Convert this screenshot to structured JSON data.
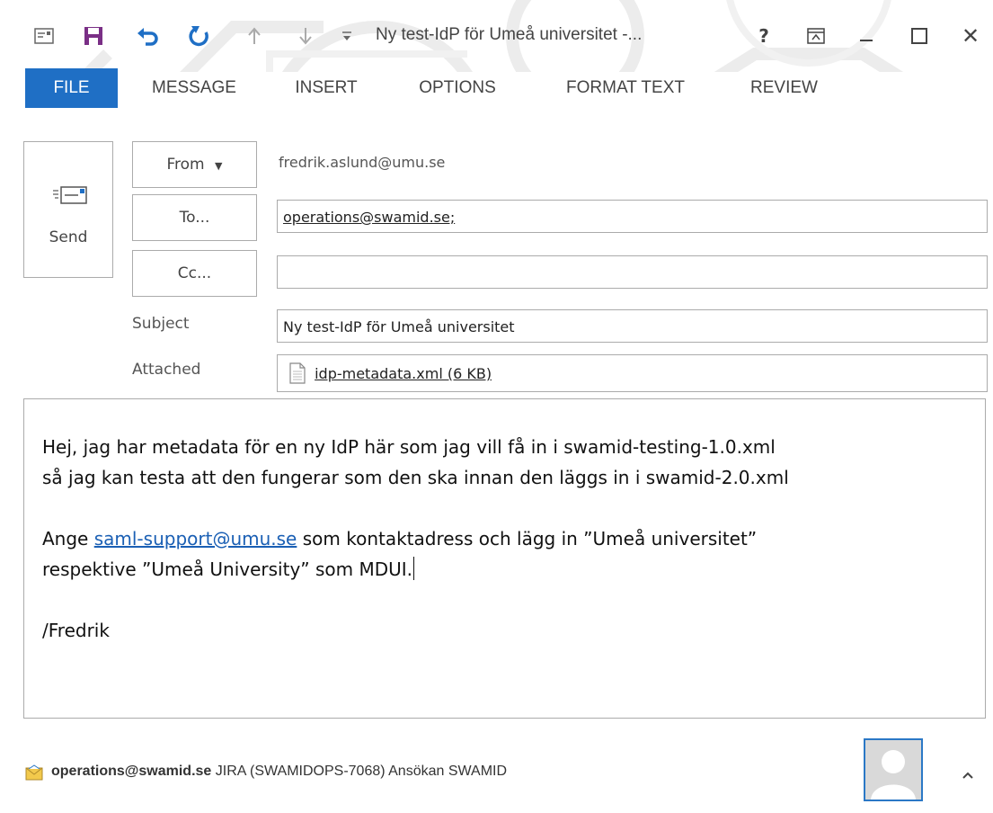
{
  "window": {
    "title": "Ny test-IdP för Umeå universitet -...",
    "help_label": "?",
    "minimize_label": "—",
    "close_label": "✕"
  },
  "ribbon": {
    "tabs": [
      "FILE",
      "MESSAGE",
      "INSERT",
      "OPTIONS",
      "FORMAT TEXT",
      "REVIEW"
    ],
    "accent_color": "#1f6fc5"
  },
  "compose": {
    "send_label": "Send",
    "from_button_label": "From",
    "from_value": "fredrik.aslund@umu.se",
    "to_button_label": "To...",
    "to_value": "operations@swamid.se;",
    "cc_button_label": "Cc...",
    "cc_value": "",
    "subject_label": "Subject",
    "subject_value": "Ny test-IdP för Umeå universitet",
    "attached_label": "Attached",
    "attachment": "idp-metadata.xml (6 KB)"
  },
  "body": {
    "line1": "Hej, jag har metadata för en ny IdP här som jag vill få in i swamid-testing-1.0.xml",
    "line2": "så jag kan testa att den fungerar som den ska innan den läggs in i swamid-2.0.xml",
    "line3_prefix": "Ange ",
    "line3_link": "saml-support@umu.se",
    "line3_suffix": " som kontaktadress och lägg in ”Umeå universitet”",
    "line4": "respektive ”Umeå University” som MDUI.",
    "signature": "/Fredrik"
  },
  "people_pane": {
    "email": "operations@swamid.se",
    "subject": "JIRA (SWAMIDOPS-7068) Ansökan SWAMID",
    "collapse_icon": "chevron-up-icon"
  }
}
